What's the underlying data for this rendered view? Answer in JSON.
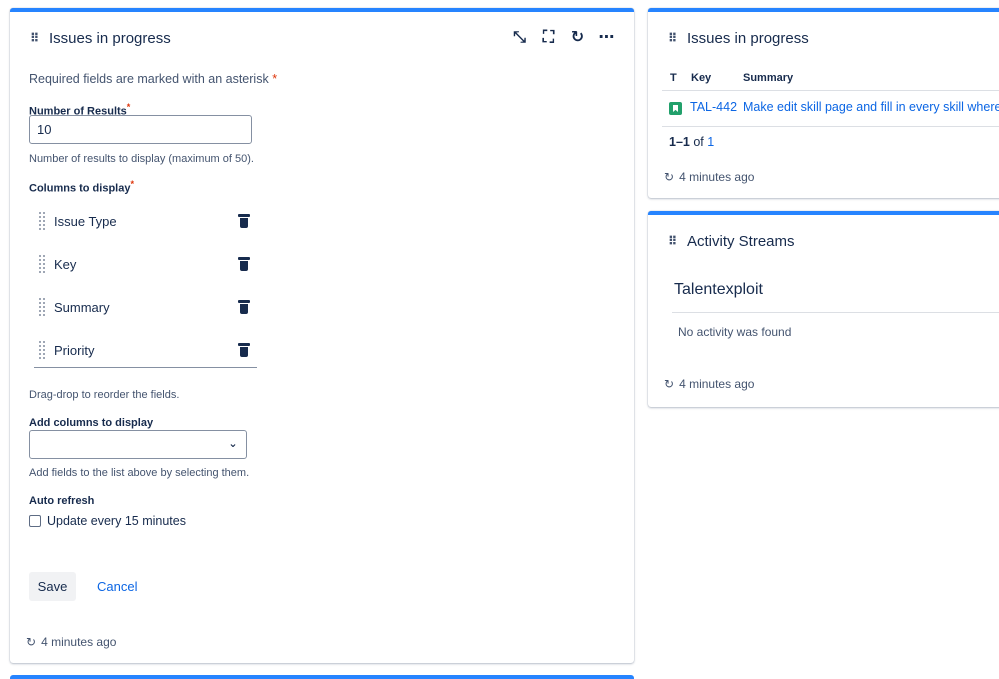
{
  "main_gadget": {
    "title": "Issues in progress",
    "required_note": "Required fields are marked with an asterisk",
    "required_star": "*",
    "num_results": {
      "label": "Number of Results",
      "value": "10",
      "help": "Number of results to display (maximum of 50)."
    },
    "columns": {
      "label": "Columns to display",
      "items": [
        "Issue Type",
        "Key",
        "Summary",
        "Priority"
      ],
      "help": "Drag-drop to reorder the fields."
    },
    "add_columns": {
      "label": "Add columns to display",
      "value": "",
      "help": "Add fields to the list above by selecting them."
    },
    "auto_refresh": {
      "label": "Auto refresh",
      "checkbox_label": "Update every 15 minutes",
      "checked": false
    },
    "save_label": "Save",
    "cancel_label": "Cancel",
    "updated": "4 minutes ago",
    "icons": [
      "drag-handle-icon",
      "minimize-icon",
      "fullscreen-icon",
      "refresh-icon",
      "more-icon"
    ]
  },
  "issues_gadget": {
    "title": "Issues in progress",
    "headers": {
      "type": "T",
      "key": "Key",
      "summary": "Summary"
    },
    "rows": [
      {
        "type_icon": "story-icon",
        "key": "TAL-442",
        "summary": "Make edit skill page and fill in every skill where"
      }
    ],
    "pager": {
      "range": "1–1",
      "of": "of",
      "total": "1"
    },
    "updated": "4 minutes ago"
  },
  "activity_gadget": {
    "title": "Activity Streams",
    "stream_title": "Talentexploit",
    "empty_message": "No activity was found",
    "updated": "4 minutes ago"
  },
  "colors": {
    "accent": "#2684ff",
    "link": "#0c66e4",
    "required": "#de350b",
    "story": "#22a06b"
  }
}
